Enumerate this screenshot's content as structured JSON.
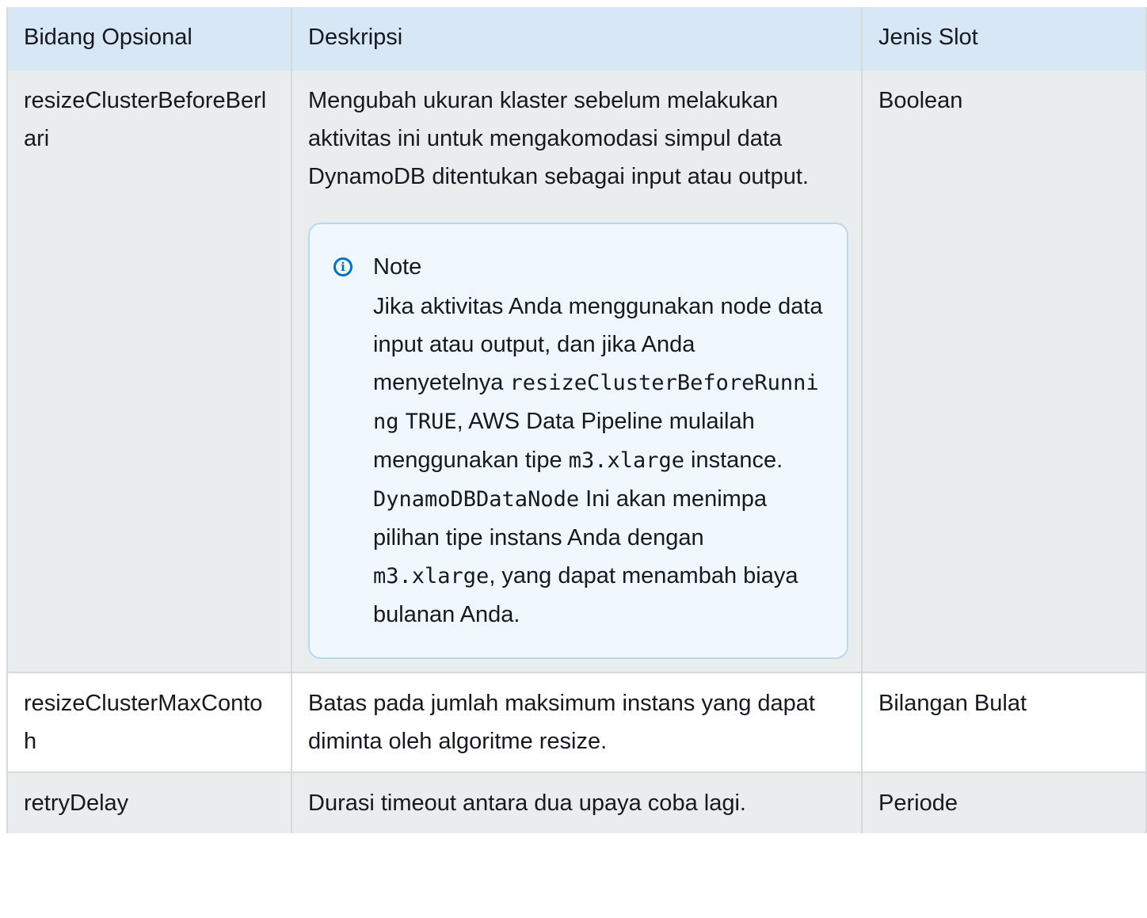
{
  "table": {
    "headers": [
      "Bidang Opsional",
      "Deskripsi",
      "Jenis Slot"
    ],
    "rows": [
      {
        "field": "resizeClusterBeforeBerlari",
        "description": "Mengubah ukuran klaster sebelum melakukan aktivitas ini untuk mengakomodasi simpul data DynamoDB ditentukan sebagai input atau output.",
        "slot_type": "Boolean",
        "note": {
          "title": "Note",
          "icon": "info-icon",
          "text_1": "Jika aktivitas Anda menggunakan node data input atau output, dan jika Anda menyetelnya ",
          "code_1": "resizeClusterBeforeRunning",
          "code_2": "TRUE",
          "text_2": ", AWS Data Pipeline mulailah menggunakan tipe ",
          "code_3": "m3.xlarge",
          "text_3": " instance. ",
          "code_4": "DynamoDBDataNode",
          "text_4": " Ini akan menimpa pilihan tipe instans Anda dengan ",
          "code_5": "m3.xlarge",
          "text_5": ", yang dapat menambah biaya bulanan Anda."
        }
      },
      {
        "field": "resizeClusterMaxContoh",
        "description": "Batas pada jumlah maksimum instans yang dapat diminta oleh algoritme resize.",
        "slot_type": "Bilangan Bulat"
      },
      {
        "field": "retryDelay",
        "description": "Durasi timeout antara dua upaya coba lagi.",
        "slot_type": "Periode"
      }
    ]
  },
  "colors": {
    "header_bg": "#d8e7f5",
    "row_alt_bg": "#eaeded",
    "note_bg": "#f1f8fd",
    "note_border": "#b9d8ef",
    "info_icon": "#0073bb"
  }
}
